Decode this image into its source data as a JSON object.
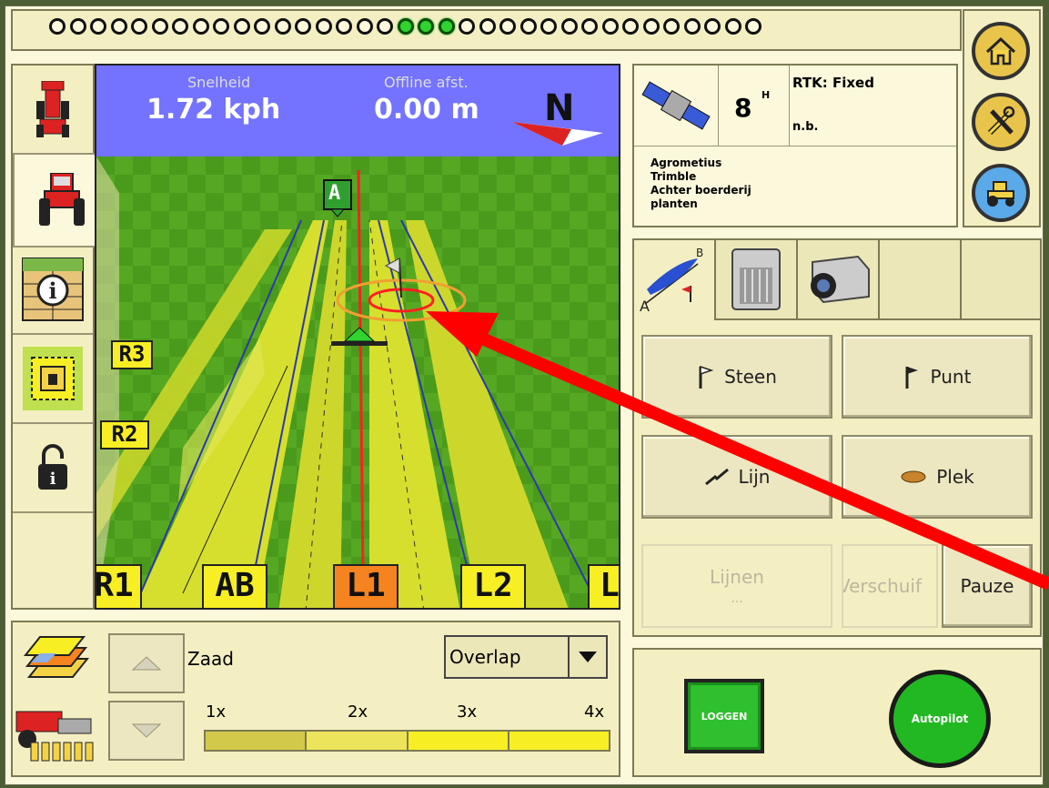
{
  "top_bar": {
    "leds": [
      "off",
      "off",
      "off",
      "off",
      "off",
      "off",
      "off",
      "off",
      "off",
      "off",
      "off",
      "off",
      "off",
      "off",
      "off",
      "off",
      "off",
      "on",
      "on",
      "on",
      "off",
      "off",
      "off",
      "off",
      "off",
      "off",
      "off",
      "off",
      "off",
      "off",
      "off",
      "off",
      "off",
      "off",
      "off"
    ]
  },
  "map": {
    "speed_label": "Snelheid",
    "speed_value": "1.72 kph",
    "offline_label": "Offline afst.",
    "offline_value": "0.00 m",
    "compass": "N",
    "marker_a": "A",
    "side_markers": [
      "R3",
      "R2"
    ],
    "lanes": [
      "R1",
      "AB",
      "L1",
      "L2",
      "L"
    ]
  },
  "gps": {
    "satellites": "8",
    "sat_suffix": "H",
    "rtk_status": "RTK: Fixed",
    "rtk_sub": "n.b."
  },
  "field_info": {
    "client": "Agrometius",
    "farm": "Trimble",
    "field": "Achter boerderij",
    "task": "planten"
  },
  "actions": {
    "steen": "Steen",
    "punt": "Punt",
    "lijn": "Lijn",
    "plek": "Plek",
    "lijnen": "Lijnen",
    "lijnen_sub": "...",
    "verschuif": "Verschuif",
    "pauze": "Pauze"
  },
  "bottom": {
    "product": "Zaad",
    "mode": "Overlap",
    "scale": [
      "1x",
      "2x",
      "3x",
      "4x"
    ]
  },
  "controls": {
    "log": "LOGGEN",
    "autopilot": "Autopilot"
  },
  "colors": {
    "accent_green": "#22b822",
    "led_on": "#2fd42f",
    "sky": "#7373ff",
    "guide_line": "#ff2020",
    "lane_yellow": "#f7ef24",
    "active_lane": "#f5831f"
  }
}
